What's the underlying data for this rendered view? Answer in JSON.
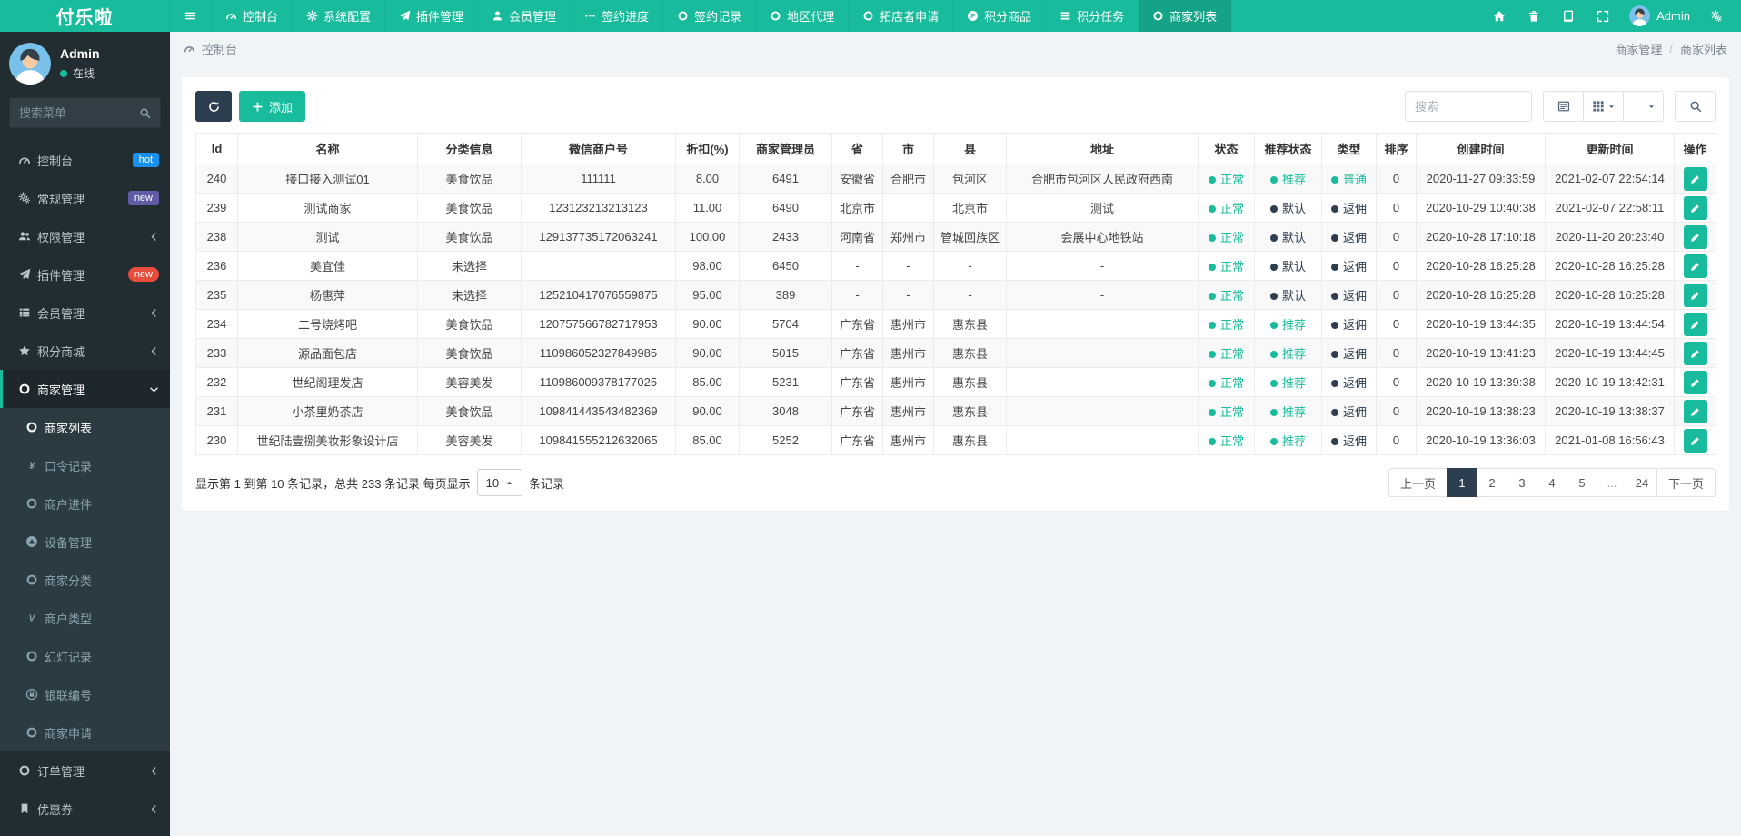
{
  "brand": {
    "logo": "付乐啦"
  },
  "colors": {
    "accent_green": "#18bc9c",
    "dark_navy": "#2c3e50",
    "sidebar_bg": "#222d32",
    "submenu_bg": "#2c3b41",
    "badge_hot_blue": "#1890f0",
    "badge_new_purple": "#605ca8",
    "badge_new_red": "#e74c3c",
    "status_green": "#18bc9c",
    "status_dark": "#2c3e50"
  },
  "topnav": {
    "items": [
      {
        "icon": "tachometer",
        "label": "控制台"
      },
      {
        "icon": "gear",
        "label": "系统配置"
      },
      {
        "icon": "paper-plane",
        "label": "插件管理"
      },
      {
        "icon": "user",
        "label": "会员管理"
      },
      {
        "icon": "ellipsis",
        "label": "签约进度"
      },
      {
        "icon": "circle",
        "label": "签约记录"
      },
      {
        "icon": "circle",
        "label": "地区代理"
      },
      {
        "icon": "circle",
        "label": "拓店者申请"
      },
      {
        "icon": "ph",
        "label": "积分商品"
      },
      {
        "icon": "tasks",
        "label": "积分任务"
      },
      {
        "icon": "circle",
        "label": "商家列表",
        "active": true
      }
    ],
    "right_icons_before": [
      {
        "icon": "home",
        "name": "home-button"
      },
      {
        "icon": "trash",
        "name": "trash-button"
      },
      {
        "icon": "book",
        "name": "log-button"
      },
      {
        "icon": "expand",
        "name": "fullscreen-button"
      }
    ],
    "user_name": "Admin",
    "right_icons_after": [
      {
        "icon": "cogs",
        "name": "settings-button"
      }
    ]
  },
  "sidebar": {
    "user": {
      "name": "Admin",
      "status": "在线"
    },
    "search_placeholder": "搜索菜单",
    "menu": [
      {
        "icon": "tachometer",
        "label": "控制台",
        "badge": {
          "text": "hot",
          "bg": "#1890f0"
        }
      },
      {
        "icon": "cogs",
        "label": "常规管理",
        "badge": {
          "text": "new",
          "bg": "#605ca8"
        }
      },
      {
        "icon": "users",
        "label": "权限管理",
        "chevron": true
      },
      {
        "icon": "paper-plane",
        "label": "插件管理",
        "badge": {
          "text": "new",
          "bg": "#e74c3c",
          "pill": true
        }
      },
      {
        "icon": "thlist",
        "label": "会员管理",
        "chevron": true
      },
      {
        "icon": "star",
        "label": "积分商城",
        "chevron": true
      },
      {
        "icon": "circle",
        "label": "商家管理",
        "active": true,
        "expanded": true,
        "children": [
          {
            "icon": "circle",
            "label": "商家列表",
            "active": true
          },
          {
            "icon": "yen",
            "label": "口令记录"
          },
          {
            "icon": "circle",
            "label": "商户进件"
          },
          {
            "icon": "adn",
            "label": "设备管理"
          },
          {
            "icon": "circle",
            "label": "商家分类"
          },
          {
            "icon": "vine",
            "label": "商户类型"
          },
          {
            "icon": "circle",
            "label": "幻灯记录"
          },
          {
            "icon": "lockring",
            "label": "银联编号"
          },
          {
            "icon": "circle",
            "label": "商家申请"
          }
        ]
      },
      {
        "icon": "circle",
        "label": "订单管理",
        "chevron": true
      },
      {
        "icon": "bookmark",
        "label": "优惠券",
        "chevron": true
      }
    ]
  },
  "breadcrumb": {
    "section": "控制台",
    "parent": "商家管理",
    "separator": "/",
    "current": "商家列表"
  },
  "toolbar": {
    "add_label": "添加",
    "search_placeholder": "搜索"
  },
  "table": {
    "columns": [
      "Id",
      "名称",
      "分类信息",
      "微信商户号",
      "折扣(%)",
      "商家管理员",
      "省",
      "市",
      "县",
      "地址",
      "状态",
      "推荐状态",
      "类型",
      "排序",
      "创建时间",
      "更新时间",
      "操作"
    ],
    "rows": [
      {
        "id": "240",
        "name": "接口接入测试01",
        "category": "美食饮品",
        "wechat": "111111",
        "discount": "8.00",
        "manager": "6491",
        "province": "安徽省",
        "city": "合肥市",
        "county": "包河区",
        "address": "合肥市包河区人民政府西南",
        "status": {
          "text": "正常",
          "tone": "green"
        },
        "recommend": {
          "text": "推荐",
          "tone": "green"
        },
        "type": {
          "text": "普通",
          "tone": "green"
        },
        "sort": "0",
        "created": "2020-11-27 09:33:59",
        "updated": "2021-02-07 22:54:14"
      },
      {
        "id": "239",
        "name": "测试商家",
        "category": "美食饮品",
        "wechat": "123123213213123",
        "discount": "11.00",
        "manager": "6490",
        "province": "北京市",
        "city": "",
        "county": "北京市",
        "address": "测试",
        "status": {
          "text": "正常",
          "tone": "green"
        },
        "recommend": {
          "text": "默认",
          "tone": "dark"
        },
        "type": {
          "text": "返佣",
          "tone": "dark"
        },
        "sort": "0",
        "created": "2020-10-29 10:40:38",
        "updated": "2021-02-07 22:58:11"
      },
      {
        "id": "238",
        "name": "测试",
        "category": "美食饮品",
        "wechat": "129137735172063241",
        "discount": "100.00",
        "manager": "2433",
        "province": "河南省",
        "city": "郑州市",
        "county": "管城回族区",
        "address": "会展中心地铁站",
        "status": {
          "text": "正常",
          "tone": "green"
        },
        "recommend": {
          "text": "默认",
          "tone": "dark"
        },
        "type": {
          "text": "返佣",
          "tone": "dark"
        },
        "sort": "0",
        "created": "2020-10-28 17:10:18",
        "updated": "2020-11-20 20:23:40"
      },
      {
        "id": "236",
        "name": "美宜佳",
        "category": "未选择",
        "wechat": "",
        "discount": "98.00",
        "manager": "6450",
        "province": "-",
        "city": "-",
        "county": "-",
        "address": "-",
        "status": {
          "text": "正常",
          "tone": "green"
        },
        "recommend": {
          "text": "默认",
          "tone": "dark"
        },
        "type": {
          "text": "返佣",
          "tone": "dark"
        },
        "sort": "0",
        "created": "2020-10-28 16:25:28",
        "updated": "2020-10-28 16:25:28"
      },
      {
        "id": "235",
        "name": "杨惠萍",
        "category": "未选择",
        "wechat": "125210417076559875",
        "discount": "95.00",
        "manager": "389",
        "province": "-",
        "city": "-",
        "county": "-",
        "address": "-",
        "status": {
          "text": "正常",
          "tone": "green"
        },
        "recommend": {
          "text": "默认",
          "tone": "dark"
        },
        "type": {
          "text": "返佣",
          "tone": "dark"
        },
        "sort": "0",
        "created": "2020-10-28 16:25:28",
        "updated": "2020-10-28 16:25:28"
      },
      {
        "id": "234",
        "name": "二号烧烤吧",
        "category": "美食饮品",
        "wechat": "120757566782717953",
        "discount": "90.00",
        "manager": "5704",
        "province": "广东省",
        "city": "惠州市",
        "county": "惠东县",
        "address": "",
        "status": {
          "text": "正常",
          "tone": "green"
        },
        "recommend": {
          "text": "推荐",
          "tone": "green"
        },
        "type": {
          "text": "返佣",
          "tone": "dark"
        },
        "sort": "0",
        "created": "2020-10-19 13:44:35",
        "updated": "2020-10-19 13:44:54"
      },
      {
        "id": "233",
        "name": "源品面包店",
        "category": "美食饮品",
        "wechat": "110986052327849985",
        "discount": "90.00",
        "manager": "5015",
        "province": "广东省",
        "city": "惠州市",
        "county": "惠东县",
        "address": "",
        "status": {
          "text": "正常",
          "tone": "green"
        },
        "recommend": {
          "text": "推荐",
          "tone": "green"
        },
        "type": {
          "text": "返佣",
          "tone": "dark"
        },
        "sort": "0",
        "created": "2020-10-19 13:41:23",
        "updated": "2020-10-19 13:44:45"
      },
      {
        "id": "232",
        "name": "世纪阁理发店",
        "category": "美容美发",
        "wechat": "110986009378177025",
        "discount": "85.00",
        "manager": "5231",
        "province": "广东省",
        "city": "惠州市",
        "county": "惠东县",
        "address": "",
        "status": {
          "text": "正常",
          "tone": "green"
        },
        "recommend": {
          "text": "推荐",
          "tone": "green"
        },
        "type": {
          "text": "返佣",
          "tone": "dark"
        },
        "sort": "0",
        "created": "2020-10-19 13:39:38",
        "updated": "2020-10-19 13:42:31"
      },
      {
        "id": "231",
        "name": "小茶里奶茶店",
        "category": "美食饮品",
        "wechat": "109841443543482369",
        "discount": "90.00",
        "manager": "3048",
        "province": "广东省",
        "city": "惠州市",
        "county": "惠东县",
        "address": "",
        "status": {
          "text": "正常",
          "tone": "green"
        },
        "recommend": {
          "text": "推荐",
          "tone": "green"
        },
        "type": {
          "text": "返佣",
          "tone": "dark"
        },
        "sort": "0",
        "created": "2020-10-19 13:38:23",
        "updated": "2020-10-19 13:38:37"
      },
      {
        "id": "230",
        "name": "世纪陆壹捌美妆形象设计店",
        "category": "美容美发",
        "wechat": "109841555212632065",
        "discount": "85.00",
        "manager": "5252",
        "province": "广东省",
        "city": "惠州市",
        "county": "惠东县",
        "address": "",
        "status": {
          "text": "正常",
          "tone": "green"
        },
        "recommend": {
          "text": "推荐",
          "tone": "green"
        },
        "type": {
          "text": "返佣",
          "tone": "dark"
        },
        "sort": "0",
        "created": "2020-10-19 13:36:03",
        "updated": "2021-01-08 16:56:43"
      }
    ]
  },
  "pagination": {
    "summary_prefix": "显示第 1 到第 10 条记录，总共 233 条记录 每页显示",
    "page_size": "10",
    "summary_suffix": "条记录",
    "prev": "上一页",
    "next": "下一页",
    "pages": [
      "1",
      "2",
      "3",
      "4",
      "5",
      "...",
      "24"
    ],
    "active_page": "1"
  }
}
